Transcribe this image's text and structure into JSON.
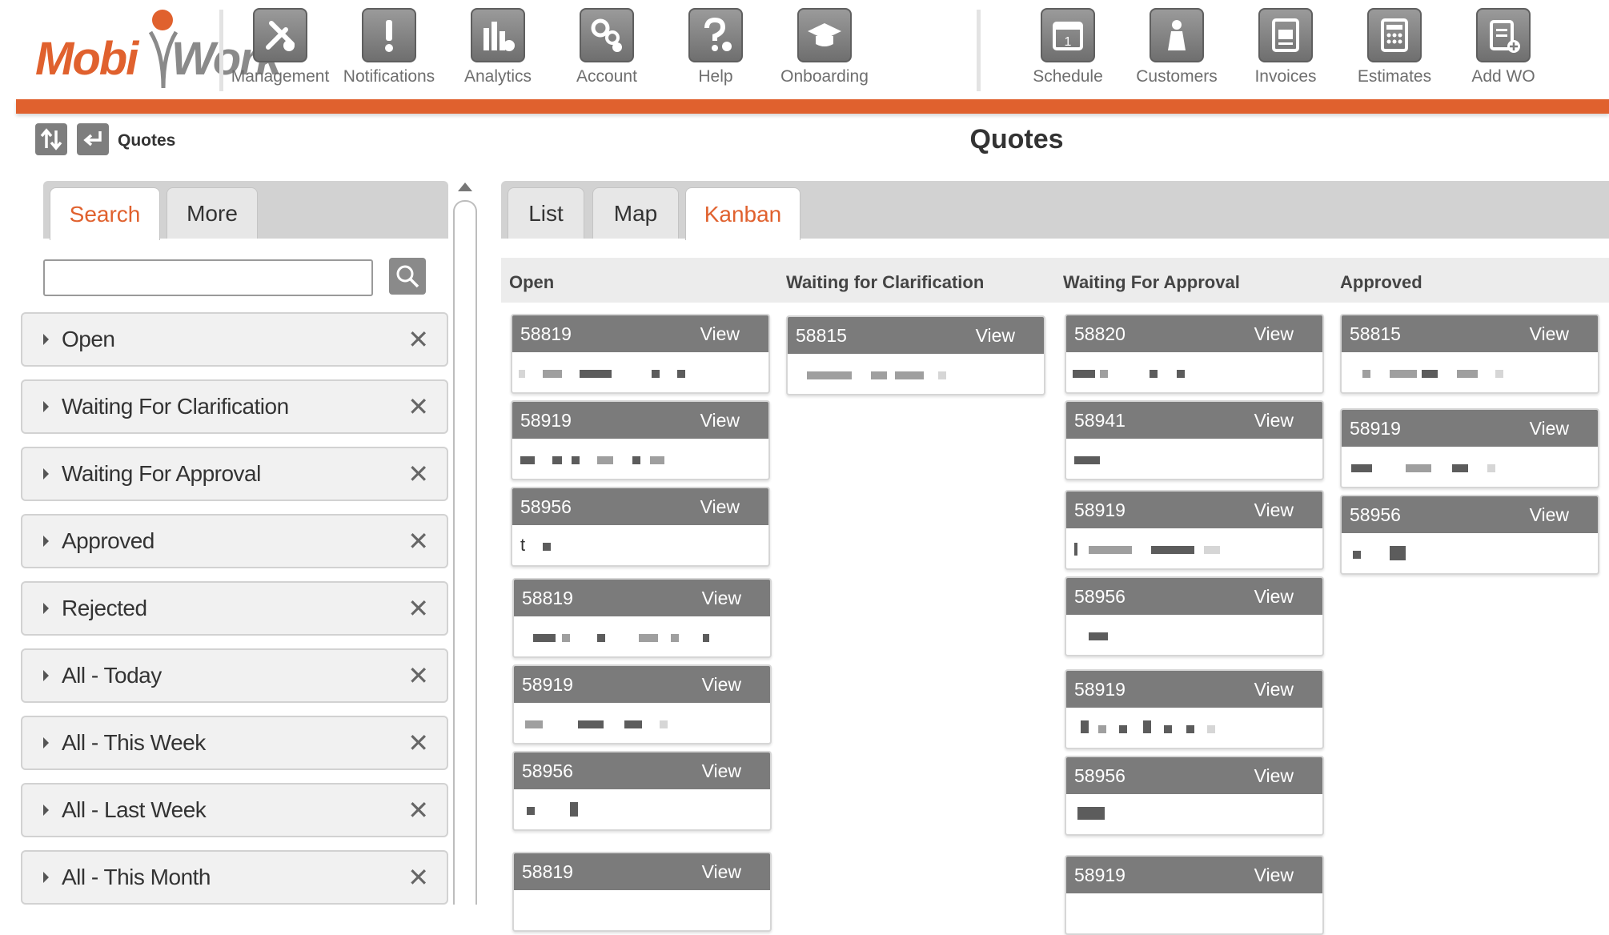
{
  "nav": {
    "items": [
      {
        "label": "Management",
        "icon": "management-icon"
      },
      {
        "label": "Notifications",
        "icon": "notifications-icon"
      },
      {
        "label": "Analytics",
        "icon": "analytics-icon"
      },
      {
        "label": "Account",
        "icon": "account-icon"
      },
      {
        "label": "Help",
        "icon": "help-icon"
      },
      {
        "label": "Onboarding",
        "icon": "onboarding-icon"
      },
      {
        "label": "Schedule",
        "icon": "schedule-icon"
      },
      {
        "label": "Customers",
        "icon": "customers-icon"
      },
      {
        "label": "Invoices",
        "icon": "invoices-icon"
      },
      {
        "label": "Estimates",
        "icon": "estimates-icon"
      },
      {
        "label": "Add WO",
        "icon": "add-wo-icon"
      }
    ]
  },
  "logo": {
    "part1": "Mobi",
    "part2": "Work"
  },
  "colors": {
    "accent": "#e0612e",
    "nav_icon": "#7b7b7b"
  },
  "breadcrumb": {
    "label": "Quotes"
  },
  "page": {
    "title": "Quotes"
  },
  "left": {
    "tabs": [
      {
        "label": "Search"
      },
      {
        "label": "More"
      }
    ],
    "search": {
      "value": "",
      "placeholder": ""
    },
    "filters": [
      {
        "label": "Open"
      },
      {
        "label": "Waiting For Clarification"
      },
      {
        "label": "Waiting For Approval"
      },
      {
        "label": "Approved"
      },
      {
        "label": "Rejected"
      },
      {
        "label": "All - Today"
      },
      {
        "label": "All - This Week"
      },
      {
        "label": "All - Last Week"
      },
      {
        "label": "All - This Month"
      }
    ],
    "close_glyph": "✕"
  },
  "main": {
    "tabs": [
      {
        "label": "List"
      },
      {
        "label": "Map"
      },
      {
        "label": "Kanban"
      }
    ],
    "active_tab": "Kanban",
    "columns": [
      {
        "title": "Open",
        "cards": [
          {
            "id": "58819",
            "action": "View"
          },
          {
            "id": "58919",
            "action": "View"
          },
          {
            "id": "58956",
            "action": "View",
            "prefix": "t"
          },
          {
            "id": "58819",
            "action": "View"
          },
          {
            "id": "58919",
            "action": "View"
          },
          {
            "id": "58956",
            "action": "View"
          },
          {
            "id": "58819",
            "action": "View"
          }
        ]
      },
      {
        "title": "Waiting for Clarification",
        "cards": [
          {
            "id": "58815",
            "action": "View"
          }
        ]
      },
      {
        "title": "Waiting For Approval",
        "cards": [
          {
            "id": "58820",
            "action": "View"
          },
          {
            "id": "58941",
            "action": "View"
          },
          {
            "id": "58919",
            "action": "View"
          },
          {
            "id": "58956",
            "action": "View"
          },
          {
            "id": "58919",
            "action": "View"
          },
          {
            "id": "58956",
            "action": "View"
          },
          {
            "id": "58919",
            "action": "View"
          }
        ]
      },
      {
        "title": "Approved",
        "cards": [
          {
            "id": "58815",
            "action": "View"
          },
          {
            "id": "58919",
            "action": "View"
          },
          {
            "id": "58956",
            "action": "View"
          }
        ]
      }
    ]
  }
}
